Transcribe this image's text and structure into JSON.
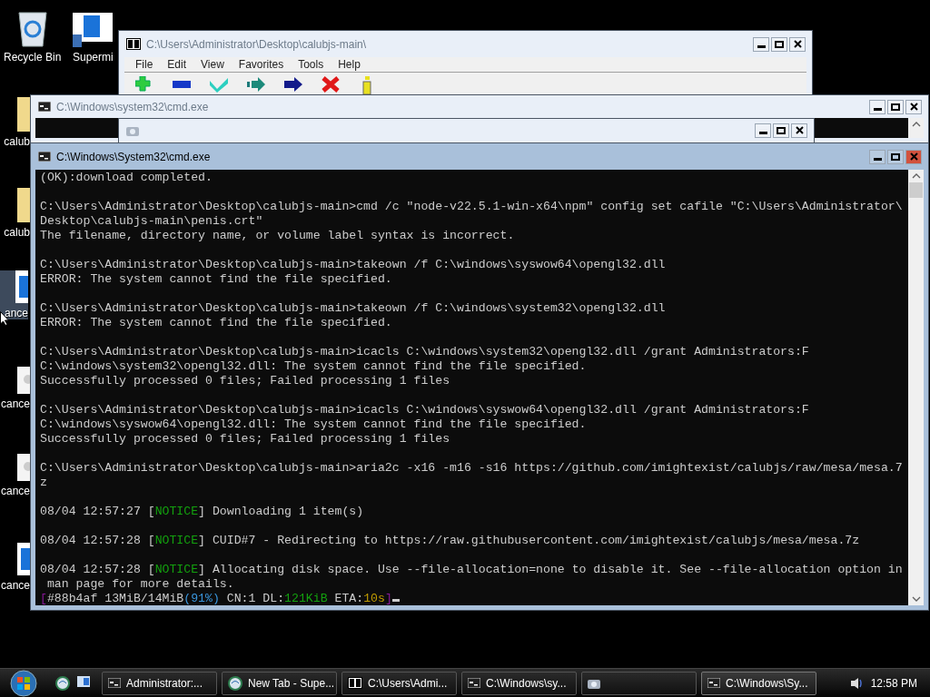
{
  "desktop_icons": [
    {
      "label": "Recycle Bin",
      "kind": "recycle",
      "selected": false
    },
    {
      "label": "Supermi",
      "kind": "shortcut",
      "selected": false
    },
    {
      "label": "calub",
      "kind": "folder",
      "selected": false
    },
    {
      "label": "calub",
      "kind": "folder",
      "selected": false
    },
    {
      "label": "ance",
      "kind": "document",
      "selected": true
    },
    {
      "label": "cance",
      "kind": "gear",
      "selected": false
    },
    {
      "label": "cance",
      "kind": "gear",
      "selected": false
    },
    {
      "label": "cance",
      "kind": "document",
      "selected": false
    }
  ],
  "windows": [
    {
      "kind": "archiver",
      "title": "C:\\Users\\Administrator\\Desktop\\calubjs-main\\",
      "active": false,
      "menu": [
        "File",
        "Edit",
        "View",
        "Favorites",
        "Tools",
        "Help"
      ]
    },
    {
      "kind": "console",
      "title": "C:\\Windows\\system32\\cmd.exe",
      "active": false
    },
    {
      "kind": "viewer",
      "active": false
    },
    {
      "kind": "console",
      "title": "C:\\Windows\\System32\\cmd.exe",
      "active": true,
      "console": {
        "cursor": true,
        "blocks": [
          {
            "lines": [
              {
                "segments": [
                  {
                    "text": "(OK):download completed."
                  }
                ]
              }
            ]
          },
          {
            "lines": [
              {
                "segments": [
                  {
                    "text": "C:\\Users\\Administrator\\Desktop\\calubjs-main>cmd /c \"node-v22.5.1-win-x64\\npm\" config set cafile \"C:\\Users\\Administrator\\"
                  }
                ]
              },
              {
                "segments": [
                  {
                    "text": "Desktop\\calubjs-main\\penis.crt\""
                  }
                ]
              },
              {
                "segments": [
                  {
                    "text": "The filename, directory name, or volume label syntax is incorrect."
                  }
                ]
              }
            ]
          },
          {
            "lines": [
              {
                "segments": [
                  {
                    "text": "C:\\Users\\Administrator\\Desktop\\calubjs-main>takeown /f C:\\windows\\syswow64\\opengl32.dll"
                  }
                ]
              },
              {
                "segments": [
                  {
                    "text": "ERROR: The system cannot find the file specified."
                  }
                ]
              }
            ]
          },
          {
            "lines": [
              {
                "segments": [
                  {
                    "text": "C:\\Users\\Administrator\\Desktop\\calubjs-main>takeown /f C:\\windows\\system32\\opengl32.dll"
                  }
                ]
              },
              {
                "segments": [
                  {
                    "text": "ERROR: The system cannot find the file specified."
                  }
                ]
              }
            ]
          },
          {
            "lines": [
              {
                "segments": [
                  {
                    "text": "C:\\Users\\Administrator\\Desktop\\calubjs-main>icacls C:\\windows\\system32\\opengl32.dll /grant Administrators:F"
                  }
                ]
              },
              {
                "segments": [
                  {
                    "text": "C:\\windows\\system32\\opengl32.dll: The system cannot find the file specified."
                  }
                ]
              },
              {
                "segments": [
                  {
                    "text": "Successfully processed 0 files; Failed processing 1 files"
                  }
                ]
              }
            ]
          },
          {
            "lines": [
              {
                "segments": [
                  {
                    "text": "C:\\Users\\Administrator\\Desktop\\calubjs-main>icacls C:\\windows\\syswow64\\opengl32.dll /grant Administrators:F"
                  }
                ]
              },
              {
                "segments": [
                  {
                    "text": "C:\\windows\\syswow64\\opengl32.dll: The system cannot find the file specified."
                  }
                ]
              },
              {
                "segments": [
                  {
                    "text": "Successfully processed 0 files; Failed processing 1 files"
                  }
                ]
              }
            ]
          },
          {
            "lines": [
              {
                "segments": [
                  {
                    "text": "C:\\Users\\Administrator\\Desktop\\calubjs-main>aria2c -x16 -m16 -s16 https://github.com/imightexist/calubjs/raw/mesa/mesa.7"
                  }
                ]
              },
              {
                "segments": [
                  {
                    "text": "z"
                  }
                ]
              }
            ]
          },
          {
            "lines": [
              {
                "segments": [
                  {
                    "text": "08/04 12:57:27 ["
                  },
                  {
                    "text": "NOTICE",
                    "color": "#13a10e"
                  },
                  {
                    "text": "] Downloading 1 item(s)"
                  }
                ]
              }
            ]
          },
          {
            "lines": [
              {
                "segments": [
                  {
                    "text": "08/04 12:57:28 ["
                  },
                  {
                    "text": "NOTICE",
                    "color": "#13a10e"
                  },
                  {
                    "text": "] CUID#7 - Redirecting to https://raw.githubusercontent.com/imightexist/calubjs/mesa/mesa.7z"
                  }
                ]
              }
            ]
          },
          {
            "lines": [
              {
                "segments": [
                  {
                    "text": "08/04 12:57:28 ["
                  },
                  {
                    "text": "NOTICE",
                    "color": "#13a10e"
                  },
                  {
                    "text": "] Allocating disk space. Use --file-allocation=none to disable it. See --file-allocation option in"
                  }
                ]
              },
              {
                "segments": [
                  {
                    "text": " man page for more details."
                  }
                ]
              },
              {
                "segments": [
                  {
                    "text": "[",
                    "color": "#881798"
                  },
                  {
                    "text": "#88b4af 13MiB/14MiB"
                  },
                  {
                    "text": "(91%)",
                    "color": "#3a96dd"
                  },
                  {
                    "text": " CN:1 DL:"
                  },
                  {
                    "text": "121KiB",
                    "color": "#13a10e"
                  },
                  {
                    "text": " ETA:"
                  },
                  {
                    "text": "10s",
                    "color": "#c19c00"
                  },
                  {
                    "text": "]",
                    "color": "#881798"
                  }
                ]
              }
            ]
          }
        ]
      }
    }
  ],
  "taskbar": {
    "items": [
      {
        "kind": "console",
        "label": "Administrator:...",
        "selected": false
      },
      {
        "kind": "browser",
        "label": "New Tab - Supe...",
        "selected": false
      },
      {
        "kind": "archiver",
        "label": "C:\\Users\\Admi...",
        "selected": false
      },
      {
        "kind": "console",
        "label": "C:\\Windows\\sy...",
        "selected": false
      },
      {
        "kind": "viewer",
        "selected": false
      },
      {
        "kind": "console",
        "label": "C:\\Windows\\Sy...",
        "selected": true
      }
    ],
    "clock": "12:58 PM"
  }
}
